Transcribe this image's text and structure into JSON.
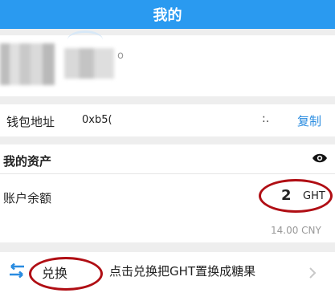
{
  "header": {
    "title": "我的"
  },
  "profile": {
    "name_fragment": "o"
  },
  "wallet": {
    "label": "钱包地址",
    "address": "0xb5(",
    "mask_char": ":.",
    "copy_label": "复制"
  },
  "assets": {
    "title": "我的资产",
    "visibility_icon": "eye-icon",
    "balance_label": "账户余额",
    "balance_amount": "2",
    "balance_unit": "GHT",
    "balance_cny": "14.00 CNY"
  },
  "exchange": {
    "icon": "swap-arrows-icon",
    "label": "兑换",
    "description": "点击兑换把GHT置换成糖果"
  },
  "colors": {
    "header_bg": "#2a9af0",
    "accent_link": "#2a8ce0",
    "annotation_red": "#b00e14",
    "page_bg": "#eeeeee"
  }
}
